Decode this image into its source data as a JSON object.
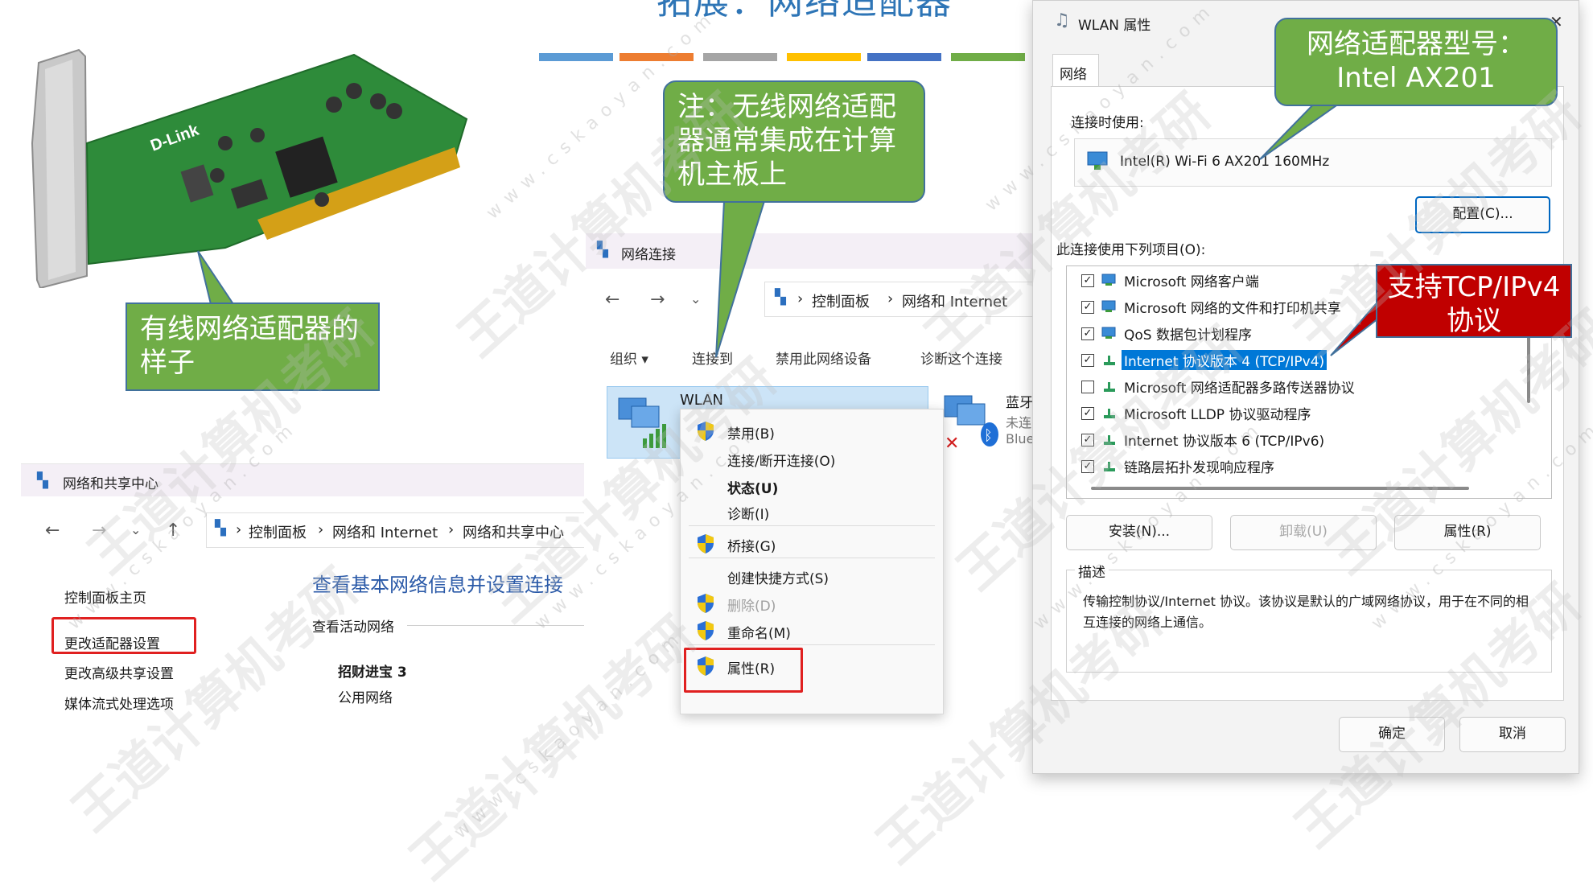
{
  "slide": {
    "title": "拓展：网络适配器",
    "bar_colors": [
      "#5b9bd5",
      "#ed7d31",
      "#a5a5a5",
      "#ffc000",
      "#4472c4",
      "#70ad47"
    ]
  },
  "watermark": {
    "text": "王道计算机考研",
    "url": "www.cskaoyan.com"
  },
  "callouts": {
    "wired": "有线网络适配器的样子",
    "integrated": "注：无线网络适配器通常集成在计算机主板上",
    "model": "网络适配器型号：Intel AX201",
    "tcp": "支持TCP/IPv4协议"
  },
  "nic_image": {
    "brand": "D-Link"
  },
  "sharing_center": {
    "title": "网络和共享中心",
    "breadcrumb": [
      "控制面板",
      "网络和 Internet",
      "网络和共享中心"
    ],
    "left_links": [
      "控制面板主页",
      "更改适配器设置",
      "更改高级共享设置",
      "媒体流式处理选项"
    ],
    "heading": "查看基本网络信息并设置连接",
    "active_networks_label": "查看活动网络",
    "network_name": "招财进宝 3",
    "network_type": "公用网络"
  },
  "net_connections": {
    "title": "网络连接",
    "breadcrumb": [
      "控制面板",
      "网络和 Internet"
    ],
    "toolbar": [
      "组织 ▾",
      "连接到",
      "禁用此网络设备",
      "诊断这个连接"
    ],
    "wlan_label": "WLAN",
    "bt_name": "蓝牙",
    "bt_status": "未连",
    "bt_device": "Blue"
  },
  "context_menu": {
    "items": [
      {
        "label": "禁用(B)",
        "shield": true,
        "state": "normal"
      },
      {
        "label": "连接/断开连接(O)",
        "shield": false,
        "state": "normal"
      },
      {
        "label": "状态(U)",
        "shield": false,
        "state": "bold"
      },
      {
        "label": "诊断(I)",
        "shield": false,
        "state": "normal"
      },
      {
        "label": "桥接(G)",
        "shield": true,
        "state": "normal"
      },
      {
        "label": "创建快捷方式(S)",
        "shield": false,
        "state": "normal"
      },
      {
        "label": "删除(D)",
        "shield": true,
        "state": "disabled"
      },
      {
        "label": "重命名(M)",
        "shield": true,
        "state": "normal"
      },
      {
        "label": "属性(R)",
        "shield": true,
        "state": "normal"
      }
    ]
  },
  "wlan_dialog": {
    "title": "WLAN 属性",
    "close_glyph": "✕",
    "tab": "网络",
    "connect_using_label": "连接时使用:",
    "adapter_name": "Intel(R) Wi-Fi 6 AX201 160MHz",
    "configure_button": "配置(C)...",
    "items_label": "此连接使用下列项目(O):",
    "items": [
      {
        "label": "Microsoft 网络客户端",
        "checked": true,
        "selected": false
      },
      {
        "label": "Microsoft 网络的文件和打印机共享",
        "checked": true,
        "selected": false
      },
      {
        "label": "QoS 数据包计划程序",
        "checked": true,
        "selected": false
      },
      {
        "label": "Internet 协议版本 4 (TCP/IPv4)",
        "checked": true,
        "selected": true
      },
      {
        "label": "Microsoft 网络适配器多路传送器协议",
        "checked": false,
        "selected": false
      },
      {
        "label": "Microsoft LLDP 协议驱动程序",
        "checked": true,
        "selected": false
      },
      {
        "label": "Internet 协议版本 6 (TCP/IPv6)",
        "checked": true,
        "selected": false
      },
      {
        "label": "链路层拓扑发现响应程序",
        "checked": true,
        "selected": false
      }
    ],
    "install_button": "安装(N)...",
    "uninstall_button": "卸载(U)",
    "properties_button": "属性(R)",
    "description_label": "描述",
    "description_text": "传输控制协议/Internet 协议。该协议是默认的广域网络协议，用于在不同的相互连接的网络上通信。",
    "ok_button": "确定",
    "cancel_button": "取消"
  },
  "colors": {
    "callout_green": "#70ad47",
    "callout_red": "#c00000",
    "highlight_red": "#e02020",
    "selection_blue": "#0078d7"
  }
}
